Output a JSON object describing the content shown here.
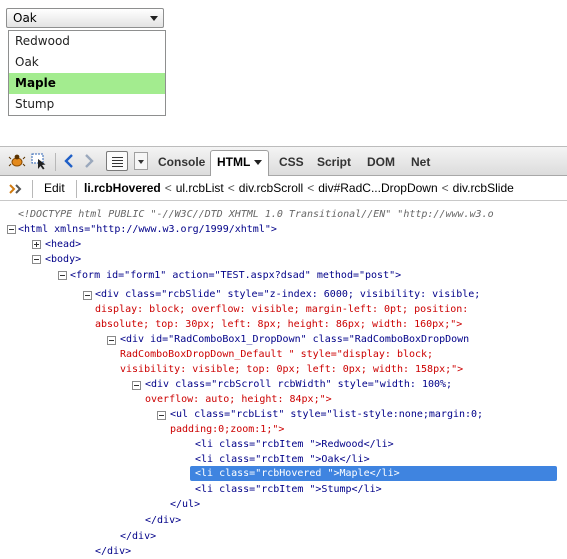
{
  "combobox": {
    "value": "Oak",
    "items": [
      "Redwood",
      "Oak",
      "Maple",
      "Stump"
    ],
    "hovered_index": 2
  },
  "toolbar": {
    "tabs": [
      "Console",
      "HTML",
      "CSS",
      "Script",
      "DOM",
      "Net"
    ],
    "active_tab": "HTML"
  },
  "breadcrumb": {
    "edit_label": "Edit",
    "items": [
      "li.rcbHovered",
      "ul.rcbList",
      "div.rcbScroll",
      "div#RadC...DropDown",
      "div.rcbSlide"
    ]
  },
  "tree": {
    "doctype": "<!DOCTYPE html PUBLIC \"-//W3C//DTD XHTML 1.0 Transitional//EN\" \"http://www.w3.o",
    "html_open": "<html xmlns=\"http://www.w3.org/1999/xhtml\">",
    "head": "<head>",
    "body_open": "<body>",
    "form_open": "<form id=\"form1\" action=\"TEST.aspx?dsad\" method=\"post\">",
    "slide_1": "<div class=\"rcbSlide\" style=\"z-index: 6000; visibility: visible;",
    "slide_2": "display: block; overflow: visible; margin-left: 0pt; position:",
    "slide_3": "absolute; top: 30px; left: 8px; height: 86px; width: 160px;\">",
    "dropdown_1": "<div id=\"RadComboBox1_DropDown\" class=\"RadComboBoxDropDown",
    "dropdown_2": "RadComboBoxDropDown_Default \" style=\"display: block;",
    "dropdown_3": "visibility: visible; top: 0px; left: 0px; width: 158px;\">",
    "scroll_1": "<div class=\"rcbScroll rcbWidth\" style=\"width: 100%;",
    "scroll_2": "overflow: auto; height: 84px;\">",
    "ul_1": "<ul class=\"rcbList\" style=\"list-style:none;margin:0;",
    "ul_2": "padding:0;zoom:1;\">",
    "li_1": "<li class=\"rcbItem \">Redwood</li>",
    "li_2": "<li class=\"rcbItem \">Oak</li>",
    "li_3": "<li class=\"rcbHovered \">Maple</li>",
    "li_4": "<li class=\"rcbItem \">Stump</li>",
    "ul_close": "</ul>",
    "div_close_1": "</div>",
    "div_close_2": "</div>",
    "div_close_3": "</div>"
  }
}
